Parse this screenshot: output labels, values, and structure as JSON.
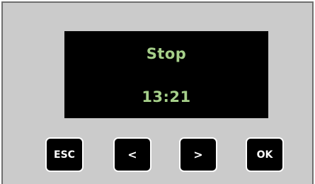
{
  "display": {
    "status": "Stop",
    "time": "13:21"
  },
  "buttons": {
    "esc_label": "ESC",
    "left_label": "<",
    "right_label": ">",
    "ok_label": "OK"
  },
  "colors": {
    "panel": "#cbcbcb",
    "panel_border": "#6f6f6f",
    "screen": "#000000",
    "screen_text": "#a6d08a",
    "button_face": "#000000",
    "button_border": "#ffffff",
    "button_text": "#ffffff"
  }
}
